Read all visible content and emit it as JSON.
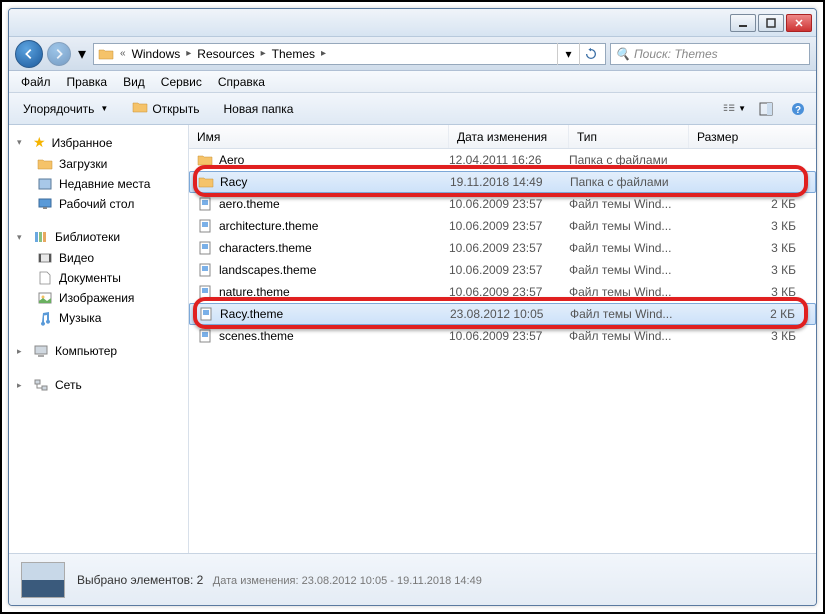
{
  "window_controls": {
    "min": "_",
    "max": "□",
    "close": "×"
  },
  "breadcrumb": [
    "Windows",
    "Resources",
    "Themes"
  ],
  "search": {
    "placeholder": "Поиск: Themes"
  },
  "menu": [
    "Файл",
    "Правка",
    "Вид",
    "Сервис",
    "Справка"
  ],
  "toolbar": {
    "organize": "Упорядочить",
    "open": "Открыть",
    "new_folder": "Новая папка"
  },
  "sidebar": {
    "favorites": {
      "label": "Избранное",
      "items": [
        {
          "label": "Загрузки",
          "icon": "download"
        },
        {
          "label": "Недавние места",
          "icon": "recent"
        },
        {
          "label": "Рабочий стол",
          "icon": "desktop"
        }
      ]
    },
    "libraries": {
      "label": "Библиотеки",
      "items": [
        {
          "label": "Видео",
          "icon": "video"
        },
        {
          "label": "Документы",
          "icon": "documents"
        },
        {
          "label": "Изображения",
          "icon": "images"
        },
        {
          "label": "Музыка",
          "icon": "music"
        }
      ]
    },
    "computer": {
      "label": "Компьютер"
    },
    "network": {
      "label": "Сеть"
    }
  },
  "columns": {
    "name": "Имя",
    "date": "Дата изменения",
    "type": "Тип",
    "size": "Размер"
  },
  "files": [
    {
      "name": "Aero",
      "date": "12.04.2011 16:26",
      "type": "Папка с файлами",
      "size": "",
      "kind": "folder",
      "selected": false
    },
    {
      "name": "Racy",
      "date": "19.11.2018 14:49",
      "type": "Папка с файлами",
      "size": "",
      "kind": "folder",
      "selected": true,
      "highlighted": true
    },
    {
      "name": "aero.theme",
      "date": "10.06.2009 23:57",
      "type": "Файл темы Wind...",
      "size": "2 КБ",
      "kind": "file",
      "selected": false
    },
    {
      "name": "architecture.theme",
      "date": "10.06.2009 23:57",
      "type": "Файл темы Wind...",
      "size": "3 КБ",
      "kind": "file",
      "selected": false
    },
    {
      "name": "characters.theme",
      "date": "10.06.2009 23:57",
      "type": "Файл темы Wind...",
      "size": "3 КБ",
      "kind": "file",
      "selected": false
    },
    {
      "name": "landscapes.theme",
      "date": "10.06.2009 23:57",
      "type": "Файл темы Wind...",
      "size": "3 КБ",
      "kind": "file",
      "selected": false
    },
    {
      "name": "nature.theme",
      "date": "10.06.2009 23:57",
      "type": "Файл темы Wind...",
      "size": "3 КБ",
      "kind": "file",
      "selected": false
    },
    {
      "name": "Racy.theme",
      "date": "23.08.2012 10:05",
      "type": "Файл темы Wind...",
      "size": "2 КБ",
      "kind": "file",
      "selected": true,
      "highlighted": true
    },
    {
      "name": "scenes.theme",
      "date": "10.06.2009 23:57",
      "type": "Файл темы Wind...",
      "size": "3 КБ",
      "kind": "file",
      "selected": false
    }
  ],
  "status": {
    "main": "Выбрано элементов: 2",
    "date_label": "Дата изменения:",
    "date_value": "23.08.2012 10:05 - 19.11.2018 14:49"
  }
}
